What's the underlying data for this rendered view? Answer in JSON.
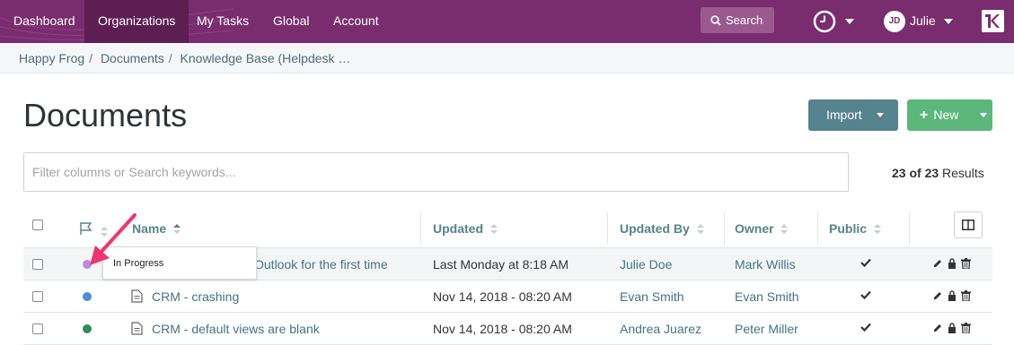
{
  "nav": {
    "items": [
      "Dashboard",
      "Organizations",
      "My Tasks",
      "Global",
      "Account"
    ],
    "search_label": "Search",
    "user_initials": "JD",
    "user_name": "Julie"
  },
  "breadcrumb": [
    "Happy Frog",
    "Documents",
    "Knowledge Base (Helpdesk …"
  ],
  "page": {
    "title": "Documents",
    "import_label": "Import",
    "new_label": "New",
    "filter_placeholder": "Filter columns or Search keywords...",
    "results_count": "23 of 23",
    "results_label": "Results"
  },
  "table": {
    "headers": {
      "name": "Name",
      "updated": "Updated",
      "updated_by": "Updated By",
      "owner": "Owner",
      "public": "Public"
    },
    "rows": [
      {
        "status_color": "#b48ce8",
        "name": "Outlook for the first time",
        "updated": "Last Monday at 8:18 AM",
        "updated_by": "Julie Doe",
        "owner": "Mark Willis"
      },
      {
        "status_color": "#4a90d9",
        "name": "CRM - crashing",
        "updated": "Nov 14, 2018 - 08:20 AM",
        "updated_by": "Evan Smith",
        "owner": "Evan Smith"
      },
      {
        "status_color": "#2e8b57",
        "name": "CRM - default views are blank",
        "updated": "Nov 14, 2018 - 08:20 AM",
        "updated_by": "Andrea Juarez",
        "owner": "Peter Miller"
      }
    ]
  },
  "tooltip": {
    "text": "In Progress"
  },
  "colors": {
    "nav_bg": "#7a2d6e",
    "accent": "#55838e",
    "new_button": "#5cb87a",
    "arrow": "#f0336e"
  }
}
